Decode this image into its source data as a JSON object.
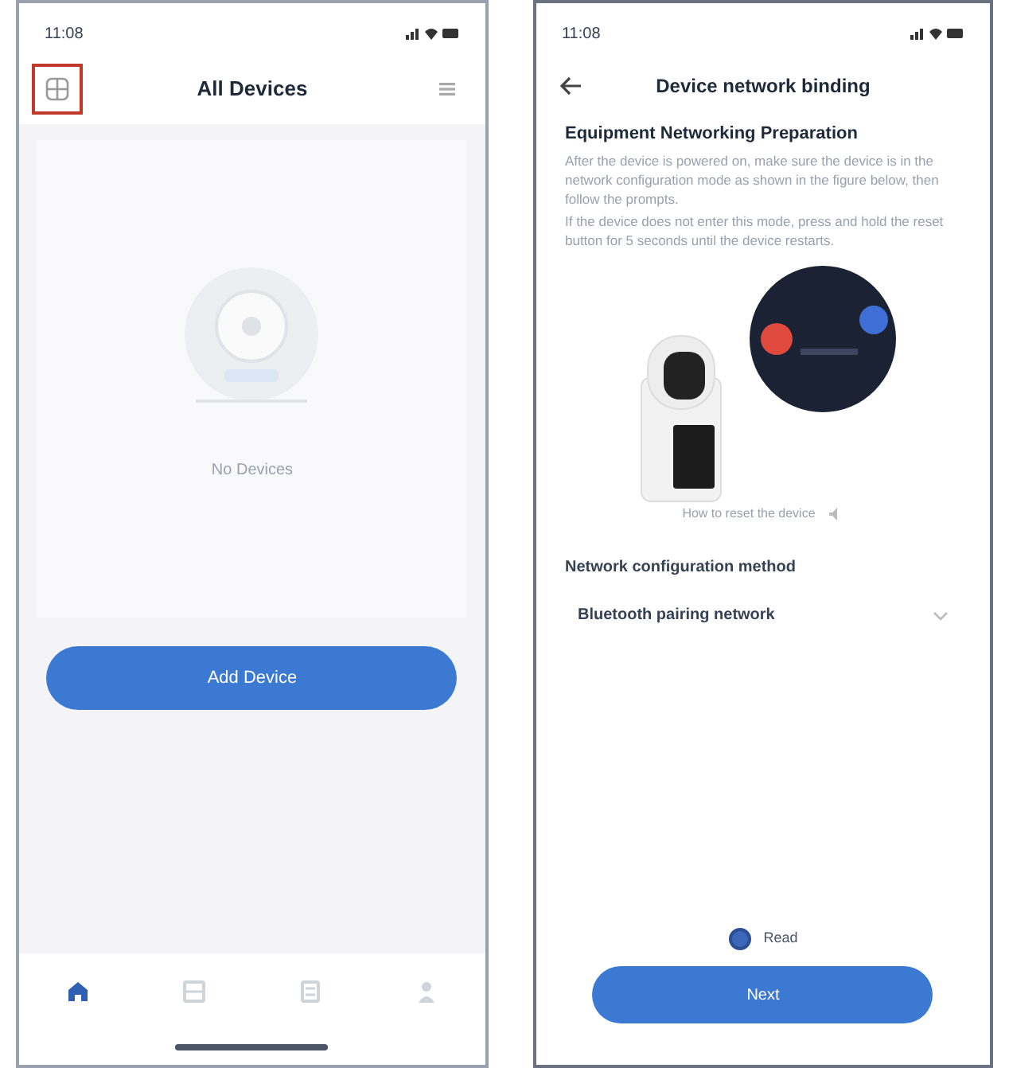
{
  "screens": [
    {
      "kind": "devices",
      "status_time": "11:08",
      "title": "All Devices",
      "empty_text": "No Devices",
      "primary_button": "Add Device",
      "tabs": [
        {
          "selected": true
        },
        {
          "selected": false
        },
        {
          "selected": false
        },
        {
          "selected": false
        }
      ]
    },
    {
      "kind": "binding",
      "status_time": "11:08",
      "title": "Device network binding",
      "heading": "Equipment Networking Preparation",
      "paragraphs": [
        "After the device is powered on, make sure the device is in the network configuration mode as shown in the figure below, then follow the prompts.",
        "If the device does not enter this mode, press and hold the reset button for 5 seconds until the device restarts."
      ],
      "caption": "How to reset the device",
      "method_label": "Network configuration method",
      "method_value": "Bluetooth pairing network",
      "agree": {
        "label": "Read",
        "checked": true
      },
      "primary_button": "Next"
    }
  ]
}
